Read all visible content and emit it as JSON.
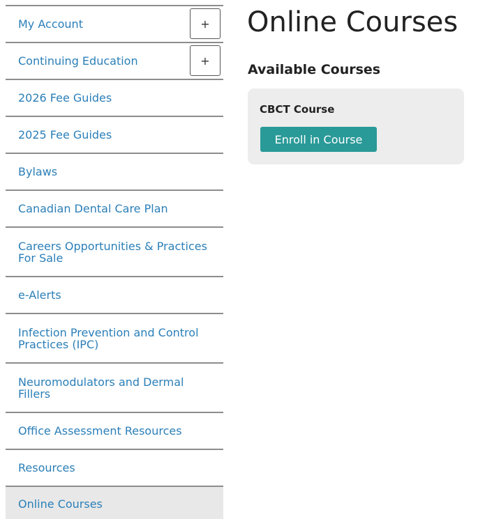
{
  "sidebar": {
    "items": [
      {
        "label": "My Account",
        "expand_symbol": "+"
      },
      {
        "label": "Continuing Education",
        "expand_symbol": "+"
      },
      {
        "label": "2026 Fee Guides"
      },
      {
        "label": "2025 Fee Guides"
      },
      {
        "label": "Bylaws"
      },
      {
        "label": "Canadian Dental Care Plan"
      },
      {
        "label": "Careers Opportunities & Practices For Sale"
      },
      {
        "label": "e-Alerts"
      },
      {
        "label": "Infection Prevention and Control Practices (IPC)"
      },
      {
        "label": "Neuromodulators and Dermal Fillers"
      },
      {
        "label": "Office Assessment Resources"
      },
      {
        "label": "Resources"
      },
      {
        "label": "Online Courses",
        "active": true
      }
    ]
  },
  "main": {
    "title": "Online Courses",
    "section_heading": "Available Courses",
    "courses": [
      {
        "name": "CBCT Course",
        "button_label": "Enroll in Course"
      }
    ]
  },
  "colors": {
    "link": "#2b7fb8",
    "accent_button": "#2a9a98",
    "card_background": "#ededed",
    "active_item_background": "#e8e8e8"
  }
}
